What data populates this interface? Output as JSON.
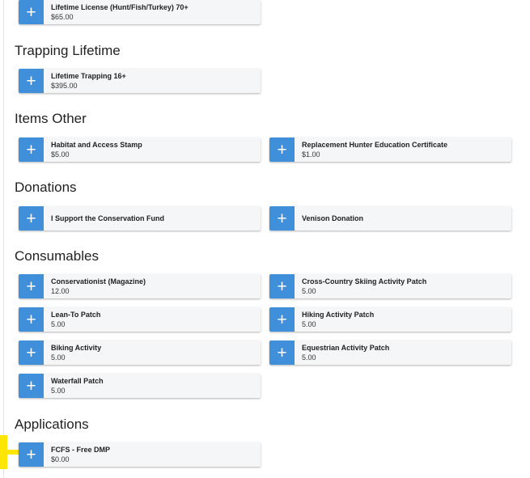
{
  "sections": [
    {
      "heading": null,
      "items": [
        {
          "title": "Lifetime License (Hunt/Fish/Turkey) 70+",
          "sub": "$65.00"
        }
      ]
    },
    {
      "heading": "Trapping Lifetime",
      "items": [
        {
          "title": "Lifetime Trapping 16+",
          "sub": "$395.00"
        }
      ]
    },
    {
      "heading": "Items Other",
      "items": [
        {
          "title": "Habitat and Access Stamp",
          "sub": "$5.00"
        },
        {
          "title": "Replacement Hunter Education Certificate",
          "sub": "$1.00"
        }
      ]
    },
    {
      "heading": "Donations",
      "items": [
        {
          "title": "I Support the Conservation Fund"
        },
        {
          "title": "Venison Donation"
        }
      ]
    },
    {
      "heading": "Consumables",
      "items": [
        {
          "title": "Conservationist (Magazine)",
          "sub": "12.00"
        },
        {
          "title": "Cross-Country Skiing Activity Patch",
          "sub": "5.00"
        },
        {
          "title": "Lean-To Patch",
          "sub": "5.00"
        },
        {
          "title": "Hiking Activity Patch",
          "sub": "5.00"
        },
        {
          "title": "Biking Activity",
          "sub": "5.00"
        },
        {
          "title": "Equestrian Activity Patch",
          "sub": "5.00"
        },
        {
          "title": "Waterfall Patch",
          "sub": "5.00"
        }
      ]
    },
    {
      "heading": "Applications",
      "items": [
        {
          "title": "FCFS - Free DMP",
          "sub": "$0.00"
        }
      ]
    }
  ],
  "add_icon": "plus-icon",
  "colors": {
    "add_button": "#3f8fdb",
    "card_bg": "#f5f6f7",
    "highlight": "#ffe600"
  }
}
